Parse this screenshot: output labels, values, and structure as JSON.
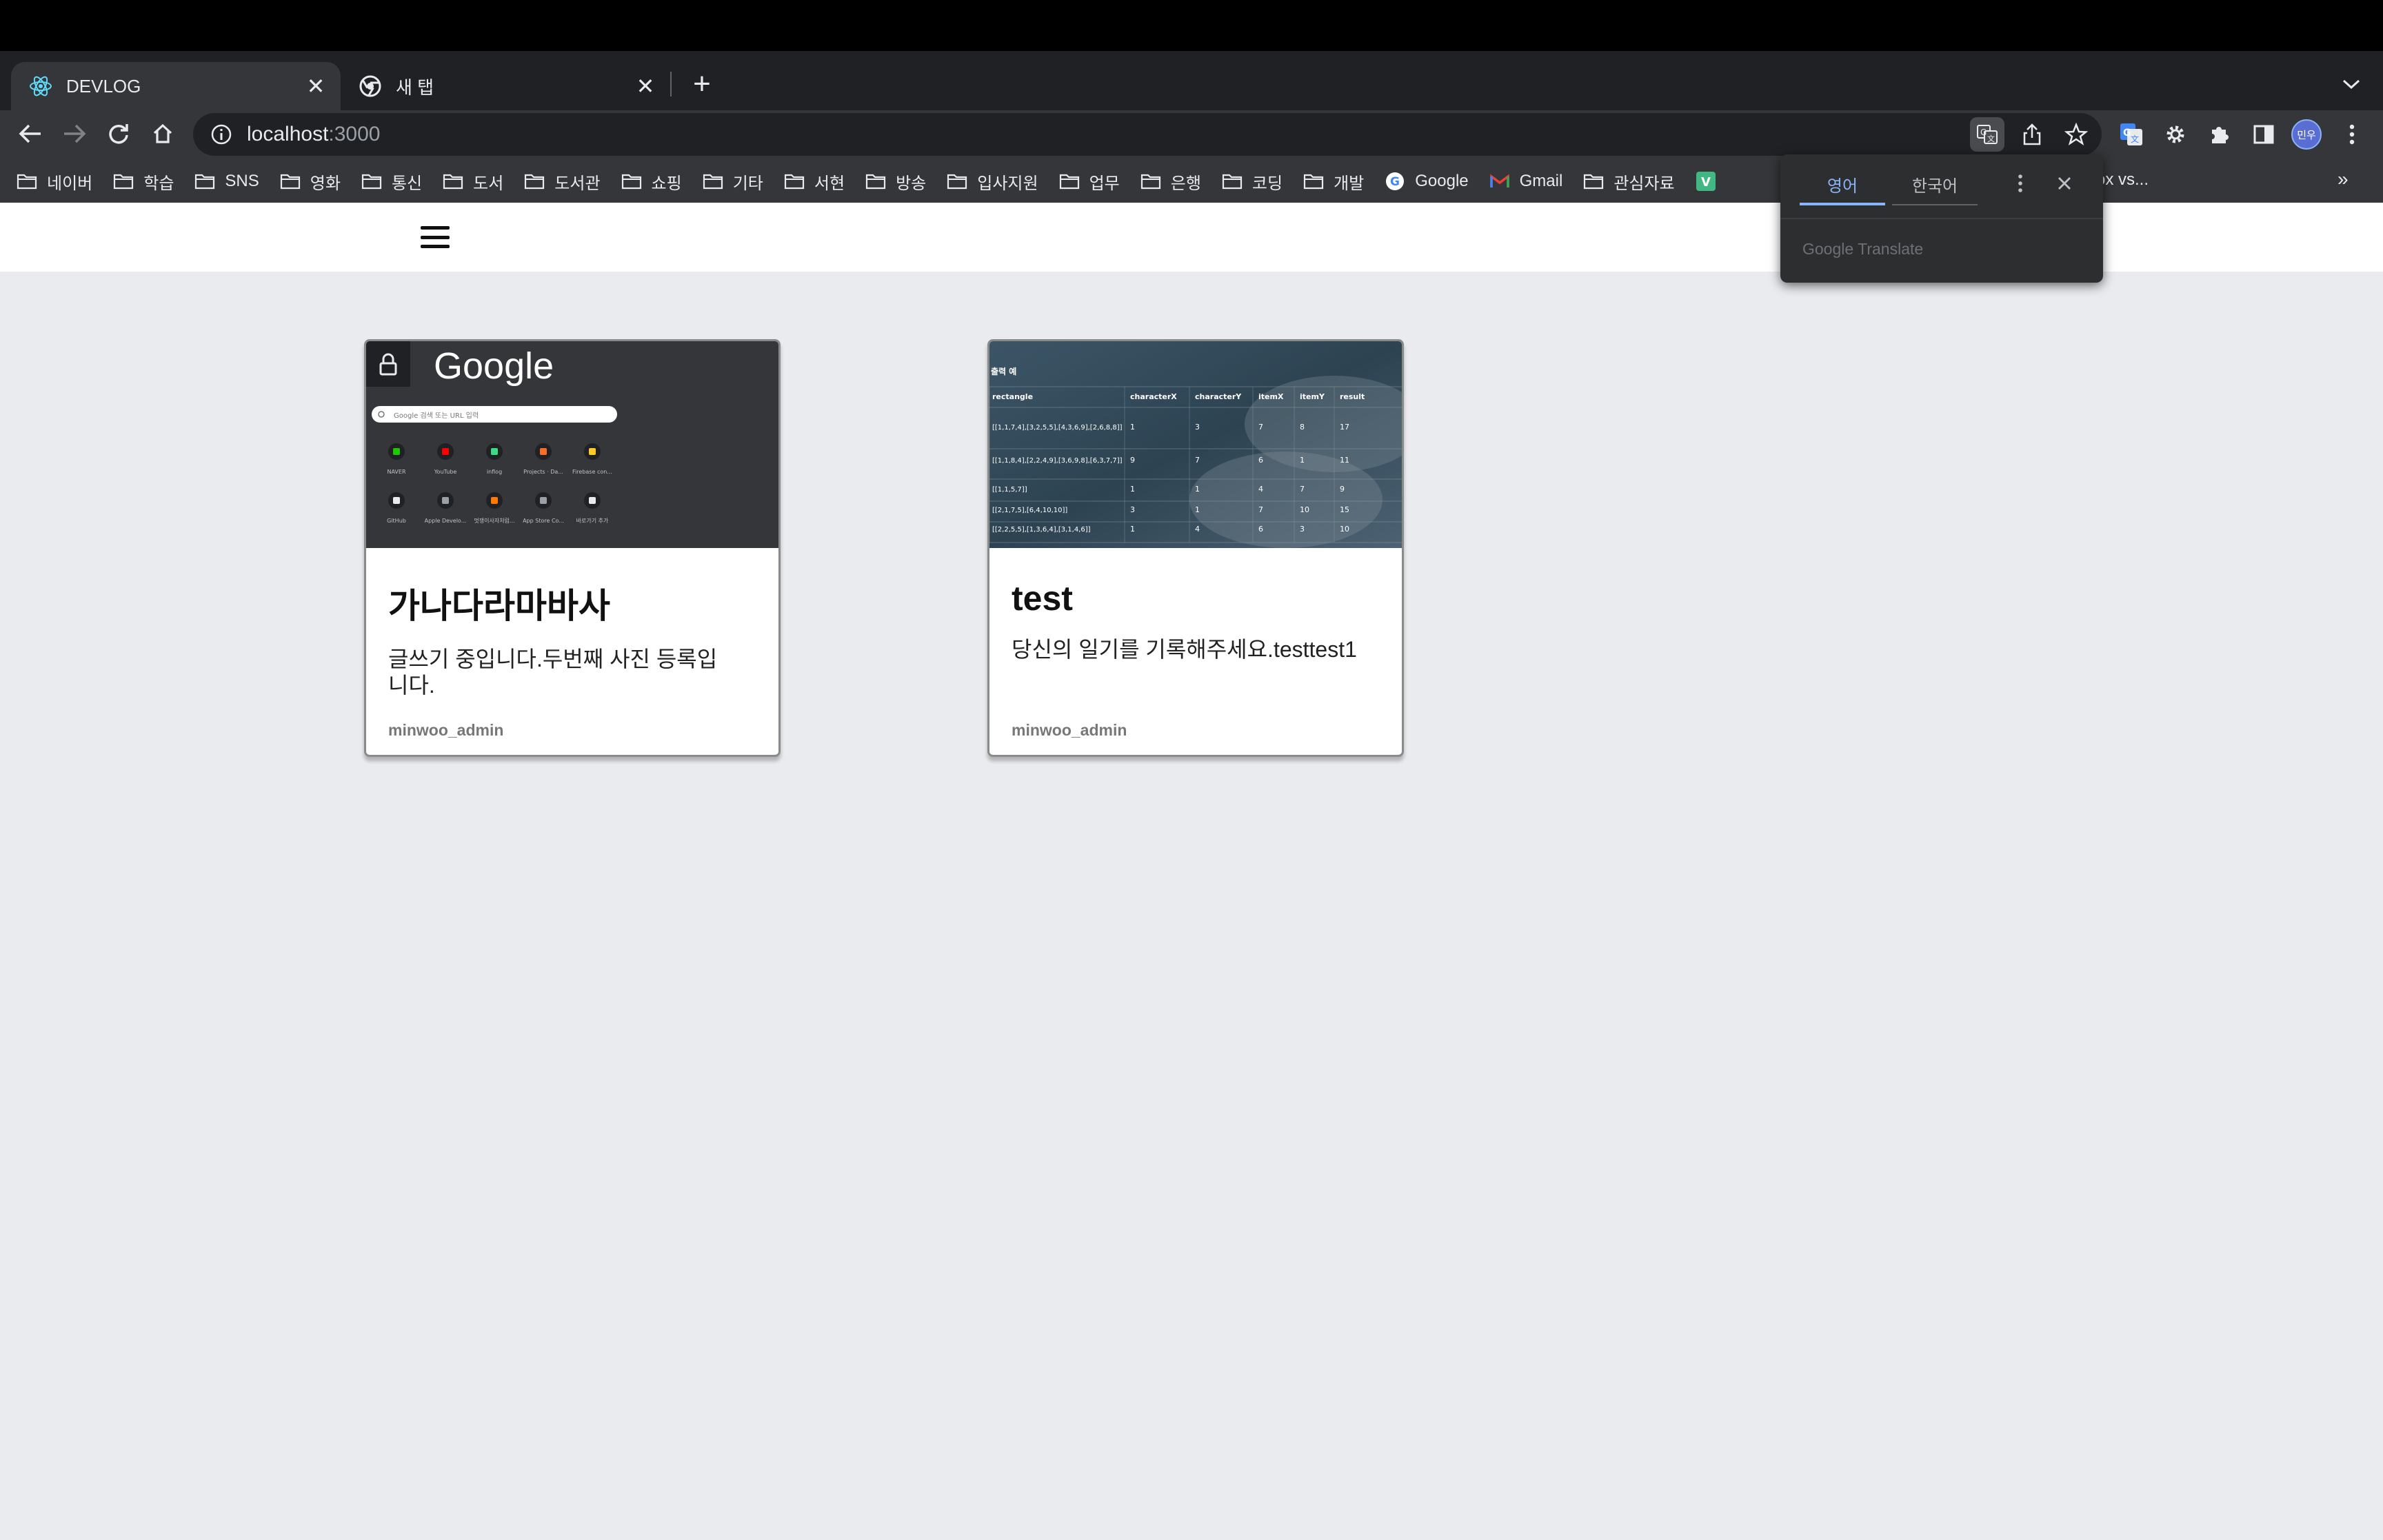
{
  "browser": {
    "tabs": [
      {
        "label": "DEVLOG",
        "active": true,
        "icon": "react-icon"
      },
      {
        "label": "새 탭",
        "active": false,
        "icon": "chrome-icon"
      }
    ],
    "url_host": "localhost",
    "url_port": ":3000",
    "bookmarks": [
      "네이버",
      "학습",
      "SNS",
      "영화",
      "통신",
      "도서",
      "도서관",
      "쇼핑",
      "기타",
      "서현",
      "방송",
      "입사지원",
      "업무",
      "은행",
      "코딩",
      "개발",
      "Google",
      "Gmail",
      "관심자료"
    ],
    "bookmark_partial": "ox vs...",
    "bookmark_more": "»",
    "profile_label": "민우"
  },
  "translate_popup": {
    "tab_source": "영어",
    "tab_target": "한국어",
    "brand": "Google Translate"
  },
  "posts": [
    {
      "title": "가나다라마바사",
      "excerpt": "글쓰기 중입니다.두번째 사진 등록입니다.",
      "author": "minwoo_admin",
      "thumb": {
        "google_logo": "Google",
        "search_placeholder": "Google 검색 또는 URL 입력",
        "shortcuts": [
          "NAVER",
          "YouTube",
          "inflog",
          "Projects · Da...",
          "Firebase con...",
          "GitHub",
          "Apple Develo...",
          "멋쟁이사자처럼...",
          "App Store Co...",
          "바로가기 추가"
        ]
      }
    },
    {
      "title": "test",
      "excerpt": "당신의 일기를 기록해주세요.testtest1",
      "author": "minwoo_admin",
      "thumb": {
        "caption": "출력 예",
        "headers": [
          "rectangle",
          "characterX",
          "characterY",
          "itemX",
          "itemY",
          "result"
        ],
        "rows": [
          [
            "[[1,1,7,4],[3,2,5,5],[4,3,6,9],[2,6,8,8]]",
            "1",
            "3",
            "7",
            "8",
            "17"
          ],
          [
            "[[1,1,8,4],[2,2,4,9],[3,6,9,8],[6,3,7,7]]",
            "9",
            "7",
            "6",
            "1",
            "11"
          ],
          [
            "[[1,1,5,7]]",
            "1",
            "1",
            "4",
            "7",
            "9"
          ],
          [
            "[[2,1,7,5],[6,4,10,10]]",
            "3",
            "1",
            "7",
            "10",
            "15"
          ],
          [
            "[[2,2,5,5],[1,3,6,4],[3,1,4,6]]",
            "1",
            "4",
            "6",
            "3",
            "10"
          ]
        ]
      }
    }
  ]
}
